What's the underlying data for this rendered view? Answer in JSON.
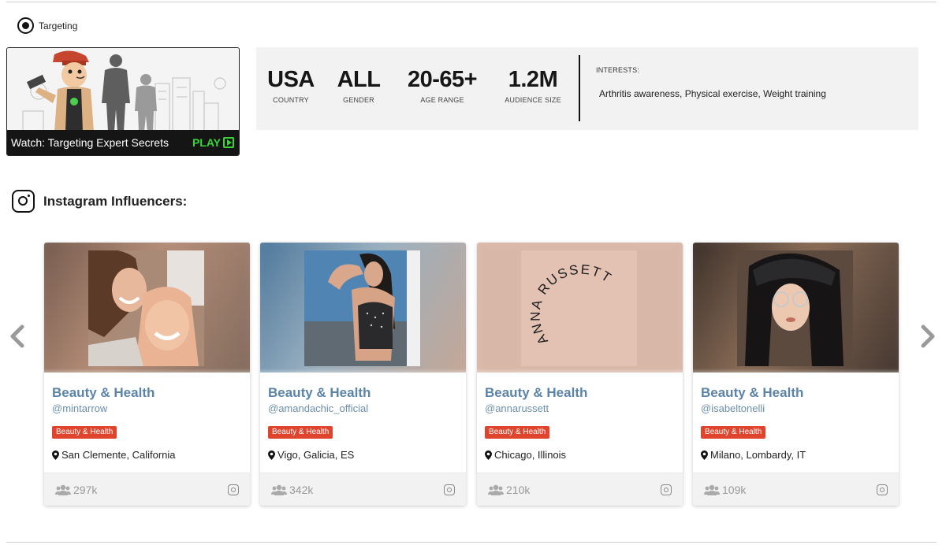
{
  "targeting": {
    "title": "Targeting",
    "video": {
      "title": "Watch: Targeting Expert Secrets",
      "play_label": "PLAY"
    },
    "stats": [
      {
        "value": "USA",
        "label": "COUNTRY"
      },
      {
        "value": "ALL",
        "label": "GENDER"
      },
      {
        "value": "20-65+",
        "label": "AGE RANGE"
      },
      {
        "value": "1.2M",
        "label": "AUDIENCE SIZE"
      }
    ],
    "interests": {
      "label": "INTERESTS:",
      "value": "Arthritis awareness, Physical exercise, Weight training"
    }
  },
  "influencers": {
    "title": "Instagram Influencers:",
    "cards": [
      {
        "category": "Beauty & Health",
        "handle": "@mintarrow",
        "badge": "Beauty & Health",
        "location": "San Clemente, California",
        "followers": "297k",
        "photo_colors": [
          "#8a6b5a",
          "#c79c86"
        ]
      },
      {
        "category": "Beauty & Health",
        "handle": "@amandachic_official",
        "badge": "Beauty & Health",
        "location": "Vigo, Galicia, ES",
        "followers": "342k",
        "photo_colors": [
          "#4c7ba3",
          "#a9b9c4"
        ]
      },
      {
        "category": "Beauty & Health",
        "handle": "@annarussett",
        "badge": "Beauty & Health",
        "location": "Chicago, Illinois",
        "followers": "210k",
        "photo_colors": [
          "#d9b7a8",
          "#e6c8bb"
        ],
        "logo_text": "ANNA RUSSETT"
      },
      {
        "category": "Beauty & Health",
        "handle": "@isabeltonelli",
        "badge": "Beauty & Health",
        "location": "Milano, Lombardy, IT",
        "followers": "109k",
        "photo_colors": [
          "#3a2e2a",
          "#9a7a62"
        ]
      }
    ]
  },
  "colors": {
    "accent_link": "#5b84a8",
    "badge": "#e0442c",
    "play": "#39d63a",
    "panel": "#f2f2f2"
  }
}
